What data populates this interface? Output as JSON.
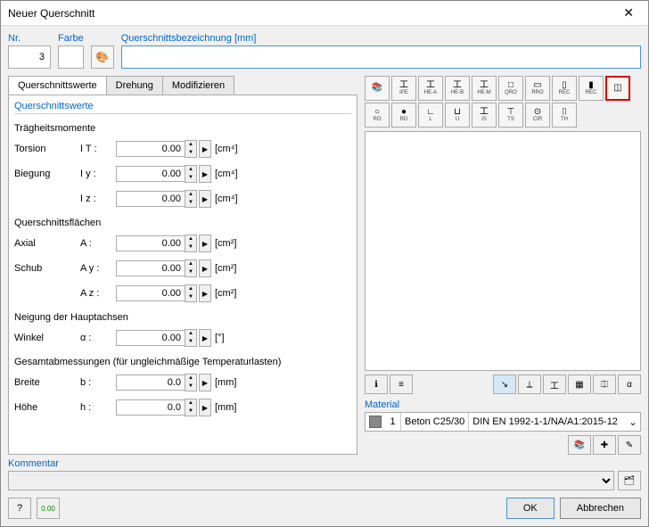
{
  "window": {
    "title": "Neuer Querschnitt"
  },
  "header": {
    "nr_label": "Nr.",
    "nr_value": "3",
    "farbe_label": "Farbe",
    "qsb_label": "Querschnittsbezeichnung [mm]",
    "qsb_value": ""
  },
  "tabs": {
    "t0": "Querschnittswerte",
    "t1": "Drehung",
    "t2": "Modifizieren"
  },
  "props": {
    "group_title": "Querschnittswerte",
    "tragheit": "Trägheitsmomente",
    "torsion_l": "Torsion",
    "torsion_s": "I T :",
    "torsion_v": "0.00",
    "torsion_u": "[cm⁴]",
    "biegung_l": "Biegung",
    "biegung_sy": "I y :",
    "biegung_vy": "0.00",
    "biegung_uy": "[cm⁴]",
    "biegung_sz": "I z :",
    "biegung_vz": "0.00",
    "biegung_uz": "[cm⁴]",
    "qfl": "Querschnittsflächen",
    "axial_l": "Axial",
    "axial_s": "A :",
    "axial_v": "0.00",
    "axial_u": "[cm²]",
    "schub_l": "Schub",
    "schub_sy": "A y :",
    "schub_vy": "0.00",
    "schub_uy": "[cm²]",
    "schub_sz": "A z :",
    "schub_vz": "0.00",
    "schub_uz": "[cm²]",
    "neig": "Neigung der Hauptachsen",
    "winkel_l": "Winkel",
    "winkel_s": "α :",
    "winkel_v": "0.00",
    "winkel_u": "[°]",
    "gesamt": "Gesamtabmessungen (für ungleichmäßige Temperaturlasten)",
    "breite_l": "Breite",
    "breite_s": "b :",
    "breite_v": "0.0",
    "breite_u": "[mm]",
    "hoehe_l": "Höhe",
    "hoehe_s": "h :",
    "hoehe_v": "0.0",
    "hoehe_u": "[mm]"
  },
  "profiles": {
    "r1": [
      {
        "glyph": "📚",
        "lbl": ""
      },
      {
        "glyph": "工",
        "lbl": "IPE"
      },
      {
        "glyph": "工",
        "lbl": "HE-A"
      },
      {
        "glyph": "工",
        "lbl": "HE-B"
      },
      {
        "glyph": "工",
        "lbl": "HE-M"
      },
      {
        "glyph": "□",
        "lbl": "QRO"
      },
      {
        "glyph": "▭",
        "lbl": "RRO"
      },
      {
        "glyph": "▯",
        "lbl": "REC"
      },
      {
        "glyph": "▮",
        "lbl": "REC"
      },
      {
        "glyph": "◫",
        "lbl": ""
      }
    ],
    "r2": [
      {
        "glyph": "○",
        "lbl": "RO"
      },
      {
        "glyph": "●",
        "lbl": "RD"
      },
      {
        "glyph": "∟",
        "lbl": "L"
      },
      {
        "glyph": "⊔",
        "lbl": "U"
      },
      {
        "glyph": "工",
        "lbl": "IS"
      },
      {
        "glyph": "⊤",
        "lbl": "TS"
      },
      {
        "glyph": "⊙",
        "lbl": "CIR"
      },
      {
        "glyph": "⌷",
        "lbl": "TH"
      }
    ]
  },
  "material": {
    "label": "Material",
    "num": "1",
    "name": "Beton C25/30",
    "norm": "DIN EN 1992-1-1/NA/A1:2015-12"
  },
  "kommentar": {
    "label": "Kommentar"
  },
  "buttons": {
    "ok": "OK",
    "cancel": "Abbrechen"
  }
}
